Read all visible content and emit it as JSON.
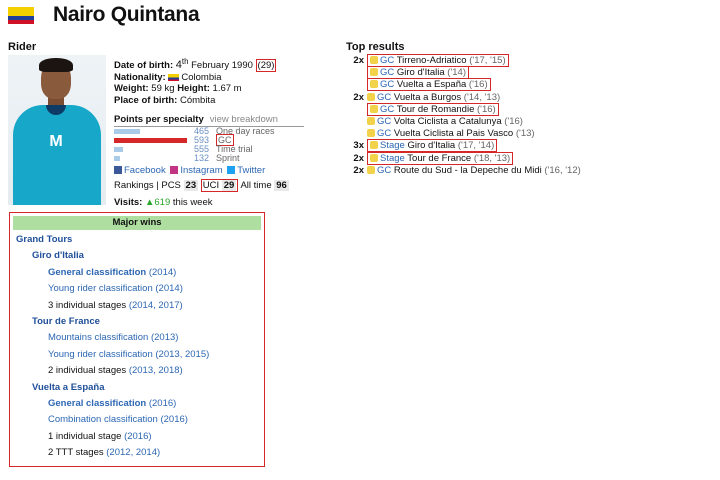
{
  "header": {
    "name": "Nairo Quintana"
  },
  "rider": {
    "section_title": "Rider",
    "dob_label": "Date of birth:",
    "dob_day": "4",
    "dob_suffix": "th",
    "dob_month": "February",
    "dob_year": "1990",
    "age": "(29)",
    "nationality_label": "Nationality:",
    "nationality": "Colombia",
    "weight_label": "Weight:",
    "weight": "59 kg",
    "height_label": "Height:",
    "height": "1.67 m",
    "pob_label": "Place of birth:",
    "pob": "Cómbita"
  },
  "specialty": {
    "title": "Points per specialty",
    "view_breakdown": "view breakdown",
    "rows": [
      {
        "value": "465",
        "label": "One day races",
        "fraction": 0.24
      },
      {
        "value": "593",
        "label": "GC",
        "fraction": 0.66
      },
      {
        "value": "555",
        "label": "Time trial",
        "fraction": 0.08
      },
      {
        "value": "132",
        "label": "Sprint",
        "fraction": 0.05
      }
    ]
  },
  "social": {
    "facebook": "Facebook",
    "instagram": "Instagram",
    "twitter": "Twitter"
  },
  "rankings": {
    "label": "Rankings | PCS",
    "pcs": "23",
    "uci_label": "UCI",
    "uci": "29",
    "alltime_label": "All time",
    "alltime": "96"
  },
  "visits": {
    "label": "Visits:",
    "arrow": "▲",
    "count": "619",
    "suffix": "this week"
  },
  "major_wins": {
    "title": "Major wins",
    "grand_tours": "Grand Tours",
    "giro": "Giro d'Italia",
    "giro_items": [
      {
        "text": "General classification",
        "years": "(2014)",
        "bold": true
      },
      {
        "text": "Young rider classification",
        "years": "(2014)",
        "bold": false
      },
      {
        "text": "3 individual stages",
        "years": "(2014, 2017)",
        "bold": false
      }
    ],
    "tour": "Tour de France",
    "tour_items": [
      {
        "text": "Mountains classification",
        "years": "(2013)"
      },
      {
        "text": "Young rider classification",
        "years": "(2013, 2015)"
      },
      {
        "text": "2 individual stages",
        "years": "(2013, 2018)"
      }
    ],
    "vuelta": "Vuelta a España",
    "vuelta_items": [
      {
        "text": "General classification",
        "years": "(2016)",
        "bold": true
      },
      {
        "text": "Combination classification",
        "years": "(2016)",
        "bold": false
      },
      {
        "text": "1 individual stage",
        "years": "(2016)",
        "bold": false
      },
      {
        "text": "2 TTT stages",
        "years": "(2012, 2014)",
        "bold": false
      }
    ]
  },
  "top_results": {
    "title": "Top results",
    "items": [
      {
        "count": "2x",
        "cat": "GC",
        "race": "Tirreno-Adriatico",
        "years": "('17, '15)"
      },
      {
        "count": "",
        "cat": "GC",
        "race": "Giro d'Italia",
        "years": "('14)"
      },
      {
        "count": "",
        "cat": "GC",
        "race": "Vuelta a España",
        "years": "('16)"
      },
      {
        "count": "2x",
        "cat": "GC",
        "race": "Vuelta a Burgos",
        "years": "('14, '13)"
      },
      {
        "count": "",
        "cat": "GC",
        "race": "Tour de Romandie",
        "years": "('16)"
      },
      {
        "count": "",
        "cat": "GC",
        "race": "Volta Ciclista a Catalunya",
        "years": "('16)"
      },
      {
        "count": "",
        "cat": "GC",
        "race": "Vuelta Ciclista al Pais Vasco",
        "years": "('13)"
      },
      {
        "count": "3x",
        "cat": "Stage",
        "race": "Giro d'Italia",
        "years": "('17, '14)"
      },
      {
        "count": "2x",
        "cat": "Stage",
        "race": "Tour de France",
        "years": "('18, '13)"
      },
      {
        "count": "2x",
        "cat": "GC",
        "race": "Route du Sud - la Depeche du Midi",
        "years": "('16, '12)"
      }
    ]
  },
  "colors": {
    "highlight_box": "#d62728",
    "link": "#2d67b3",
    "major_wins_header": "#aedea0"
  }
}
